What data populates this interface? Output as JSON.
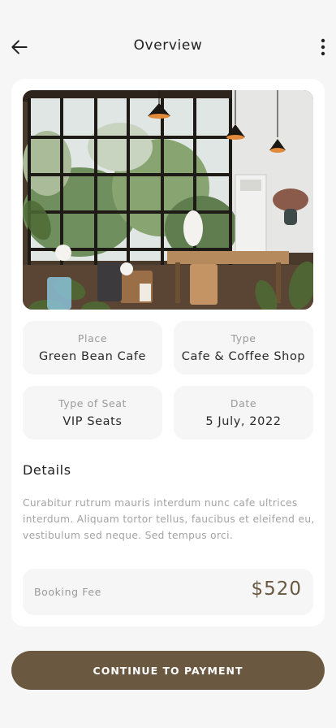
{
  "header": {
    "title": "Overview",
    "back_icon": "arrow-left-icon",
    "more_icon": "more-vertical-icon"
  },
  "photo": {
    "subject": "cafe-interior-photo"
  },
  "info": {
    "place_label": "Place",
    "place_value": "Green Bean Cafe",
    "type_label": "Type",
    "type_value": "Cafe & Coffee Shop",
    "seat_label": "Type of Seat",
    "seat_value": "VIP Seats",
    "date_label": "Date",
    "date_value": "5 July, 2022"
  },
  "details": {
    "title": "Details",
    "text": "Curabitur rutrum mauris interdum nunc  cafe ultrices interdum. Aliquam tortor tellus, faucibus et eleifend eu, vestibulum sed neque. Sed tempus orci."
  },
  "fee": {
    "label": "Booking Fee",
    "value": "$520"
  },
  "cta": {
    "label": "CONTINUE TO PAYMENT"
  },
  "colors": {
    "accent": "#6b5840",
    "background": "#f6f6f7",
    "card": "#ffffff"
  }
}
